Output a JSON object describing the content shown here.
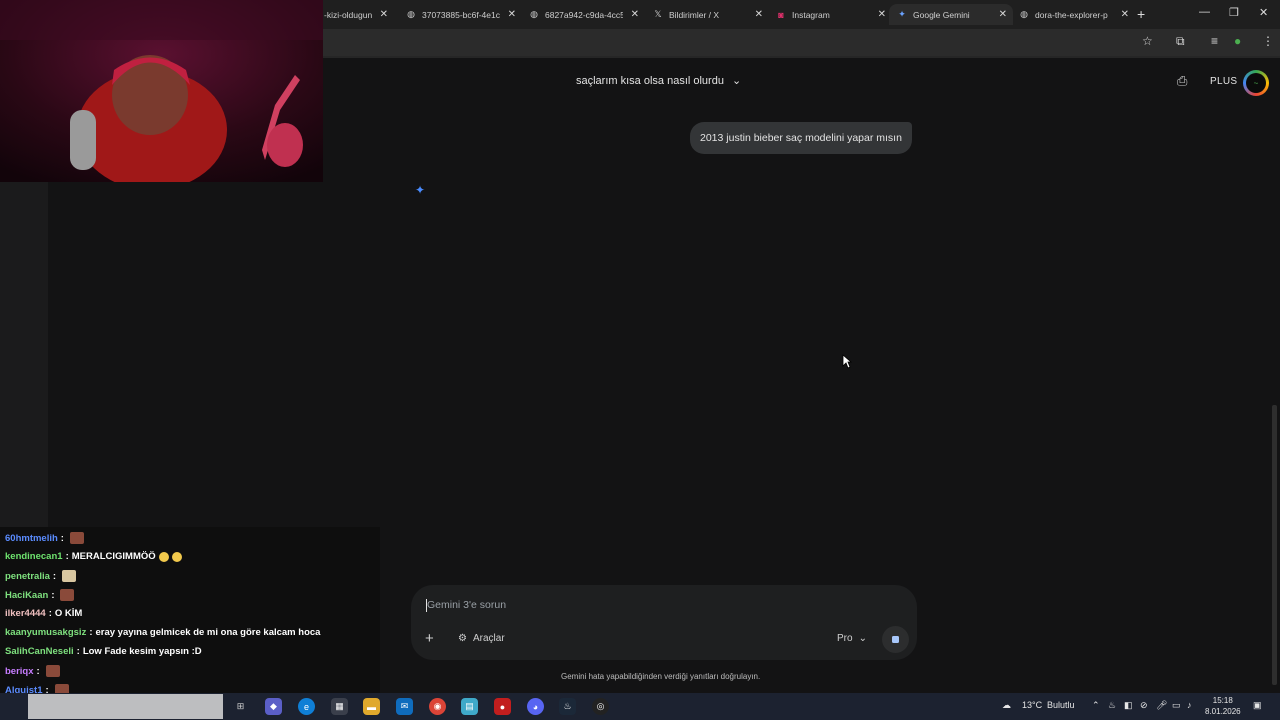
{
  "browser": {
    "tabs": [
      {
        "title": "-kizi-oldugun",
        "icon": "page-icon"
      },
      {
        "title": "37073885-bc6f-4e1c",
        "icon": "globe-icon"
      },
      {
        "title": "6827a942-c9da-4cc5",
        "icon": "globe-icon"
      },
      {
        "title": "Bildirimler / X",
        "icon": "x-logo-icon"
      },
      {
        "title": "Instagram",
        "icon": "instagram-icon"
      },
      {
        "title": "Google Gemini",
        "icon": "gemini-icon",
        "active": true
      },
      {
        "title": "dora-the-explorer-p",
        "icon": "globe-icon"
      }
    ],
    "close_glyph": "✕",
    "new_tab_glyph": "+"
  },
  "gemini": {
    "conversation_title": "saçlarım kısa olsa nasıl olurdu",
    "plan_badge": "PLUS",
    "user_message": "2013 justin bieber saç modelini yapar mısın",
    "input_placeholder": "Gemini 3'e sorun",
    "tools_label": "Araçlar",
    "model_label": "Pro",
    "disclaimer": "Gemini hata yapabildiğinden verdiği yanıtları doğrulayın."
  },
  "chat": {
    "messages": [
      {
        "user": "60hmtmelih",
        "color": "#5b8cff",
        "text": "",
        "emote": "dark"
      },
      {
        "user": "kendinecan1",
        "color": "#6ee36e",
        "text": "MERALCIGIMMÖÖ",
        "emote": "laugh"
      },
      {
        "user": "penetralia",
        "color": "#7ee07e",
        "text": "",
        "emote": "light"
      },
      {
        "user": "HaciKaan",
        "color": "#7ee07e",
        "text": "",
        "emote": "dark"
      },
      {
        "user": "ilker4444",
        "color": "#f0c0c0",
        "text": "O KİM",
        "emote": ""
      },
      {
        "user": "kaanyumusakgsiz",
        "color": "#7ee07e",
        "text": "eray yayına gelmicek de mi ona göre kalcam hoca",
        "emote": ""
      },
      {
        "user": "SalihCanNeseli",
        "color": "#7ee07e",
        "text": "Low Fade kesim yapsın :D",
        "emote": ""
      },
      {
        "user": "beriqx",
        "color": "#c77dff",
        "text": "",
        "emote": "dark"
      },
      {
        "user": "Alquist1",
        "color": "#5b8cff",
        "text": "",
        "emote": "dark"
      }
    ]
  },
  "taskbar": {
    "weather_temp": "13°C",
    "weather_desc": "Bulutlu",
    "time": "15:18",
    "date": "8.01.2026"
  }
}
